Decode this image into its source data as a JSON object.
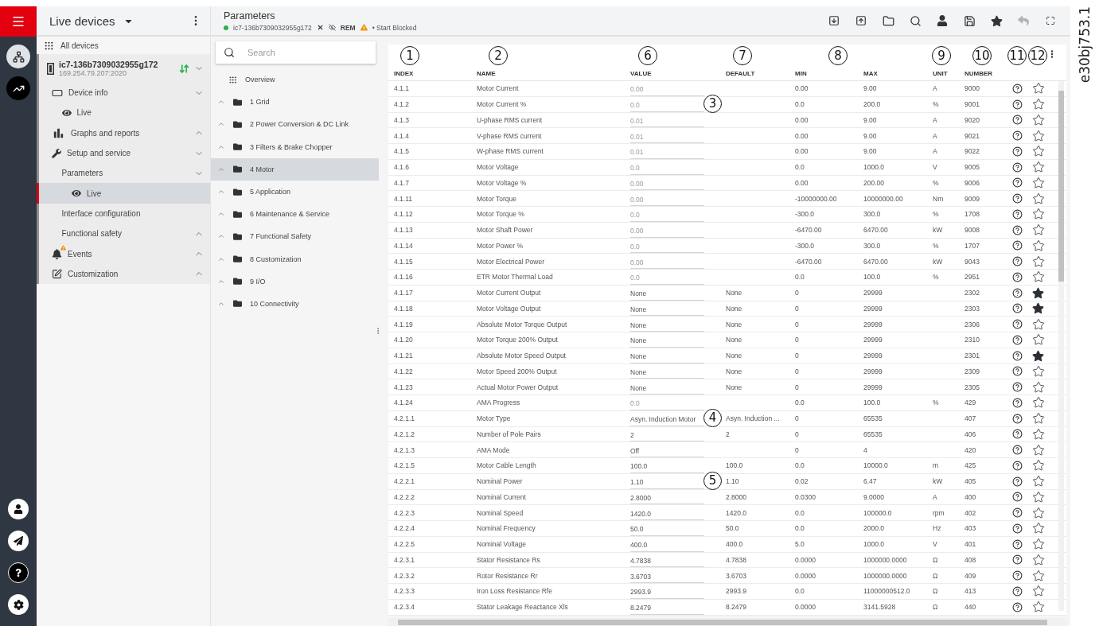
{
  "figure_label": "e30bj753.1",
  "rail": {
    "top": [
      {
        "selected": true
      },
      {
        "selected": false
      }
    ]
  },
  "sidebar": {
    "title": "Live devices",
    "all_devices": "All devices",
    "device": {
      "name": "ic7-136b7309032955g172",
      "address": "169.254.79.207:2020",
      "expanded": true
    },
    "items": [
      {
        "label": "Device info",
        "kind": "group",
        "expanded": true,
        "selected": false,
        "children": [
          {
            "label": "Live",
            "kind": "view",
            "selected": false
          }
        ]
      },
      {
        "label": "Graphs and reports",
        "kind": "group",
        "expanded": false,
        "selected": false
      },
      {
        "label": "Setup and service",
        "kind": "group",
        "expanded": true,
        "selected": false,
        "children": [
          {
            "label": "Parameters",
            "kind": "group",
            "expanded": true,
            "selected": false,
            "children": [
              {
                "label": "Live",
                "kind": "view",
                "selected": true
              }
            ]
          },
          {
            "label": "Interface configuration",
            "kind": "link",
            "selected": false
          },
          {
            "label": "Functional safety",
            "kind": "group",
            "expanded": false,
            "selected": false
          }
        ]
      },
      {
        "label": "Events",
        "kind": "group",
        "expanded": false,
        "selected": false,
        "warning": true
      },
      {
        "label": "Customization",
        "kind": "group",
        "expanded": false,
        "selected": false
      }
    ]
  },
  "header": {
    "title": "Parameters",
    "device": "ic7-136b7309032955g172",
    "online": true,
    "mode": "REM",
    "warning": true,
    "status": "• Start Blocked",
    "toolbar": [
      {
        "disabled": false
      },
      {
        "disabled": false
      },
      {
        "disabled": false
      },
      {
        "disabled": false
      },
      {
        "disabled": false
      },
      {
        "disabled": false
      },
      {
        "disabled": false
      },
      {
        "disabled": true
      },
      {
        "disabled": false
      }
    ]
  },
  "tree": {
    "search": {
      "placeholder": "Search"
    },
    "overview": "Overview",
    "groups": [
      {
        "label": "1 Grid",
        "selected": false
      },
      {
        "label": "2 Power Conversion & DC Link",
        "selected": false
      },
      {
        "label": "3 Filters & Brake Chopper",
        "selected": false
      },
      {
        "label": "4 Motor",
        "selected": true
      },
      {
        "label": "5 Application",
        "selected": false
      },
      {
        "label": "6 Maintenance & Service",
        "selected": false
      },
      {
        "label": "7 Functional Safety",
        "selected": false
      },
      {
        "label": "8 Customization",
        "selected": false
      },
      {
        "label": "9 I/O",
        "selected": false
      },
      {
        "label": "10 Connectivity",
        "selected": false
      }
    ]
  },
  "table": {
    "columns": [
      {
        "label": "INDEX",
        "callout": "1"
      },
      {
        "label": "NAME",
        "callout": "2"
      },
      {
        "label": "VALUE",
        "callout": "6"
      },
      {
        "label": "DEFAULT",
        "callout": "7"
      },
      {
        "label": "MIN",
        "callout": "8"
      },
      {
        "label": "MAX"
      },
      {
        "label": "UNIT",
        "callout": "9"
      },
      {
        "label": "NUMBER",
        "callout": "10"
      },
      {
        "callout": "11"
      },
      {
        "callout": "12"
      }
    ],
    "rows": [
      {
        "index": "4.1.1",
        "name": "Motor Current",
        "value": "0.00",
        "readonly": true,
        "min": "0.00",
        "max": "9.00",
        "unit": "A",
        "number": "9000",
        "favorite": false
      },
      {
        "index": "4.1.2",
        "name": "Motor Current %",
        "value": "0.0",
        "readonly": true,
        "min": "0.0",
        "max": "200.0",
        "unit": "%",
        "number": "9001",
        "favorite": false,
        "callout": "3"
      },
      {
        "index": "4.1.3",
        "name": "U-phase RMS current",
        "value": "0.01",
        "readonly": true,
        "min": "0.00",
        "max": "9.00",
        "unit": "A",
        "number": "9020",
        "favorite": false
      },
      {
        "index": "4.1.4",
        "name": "V-phase RMS current",
        "value": "0.01",
        "readonly": true,
        "min": "0.00",
        "max": "9.00",
        "unit": "A",
        "number": "9021",
        "favorite": false
      },
      {
        "index": "4.1.5",
        "name": "W-phase RMS current",
        "value": "0.01",
        "readonly": true,
        "min": "0.00",
        "max": "9.00",
        "unit": "A",
        "number": "9022",
        "favorite": false
      },
      {
        "index": "4.1.6",
        "name": "Motor Voltage",
        "value": "0.0",
        "readonly": true,
        "min": "0.0",
        "max": "1000.0",
        "unit": "V",
        "number": "9005",
        "favorite": false
      },
      {
        "index": "4.1.7",
        "name": "Motor Voltage %",
        "value": "0.00",
        "readonly": true,
        "min": "0.00",
        "max": "200.00",
        "unit": "%",
        "number": "9006",
        "favorite": false
      },
      {
        "index": "4.1.11",
        "name": "Motor Torque",
        "value": "0.00",
        "readonly": true,
        "min": "-10000000.00",
        "max": "10000000.00",
        "unit": "Nm",
        "number": "9009",
        "favorite": false
      },
      {
        "index": "4.1.12",
        "name": "Motor Torque %",
        "value": "0.0",
        "readonly": true,
        "min": "-300.0",
        "max": "300.0",
        "unit": "%",
        "number": "1708",
        "favorite": false
      },
      {
        "index": "4.1.13",
        "name": "Motor Shaft Power",
        "value": "0.00",
        "readonly": true,
        "min": "-6470.00",
        "max": "6470.00",
        "unit": "kW",
        "number": "9008",
        "favorite": false
      },
      {
        "index": "4.1.14",
        "name": "Motor Power %",
        "value": "0.0",
        "readonly": true,
        "min": "-300.0",
        "max": "300.0",
        "unit": "%",
        "number": "1707",
        "favorite": false
      },
      {
        "index": "4.1.15",
        "name": "Motor Electrical Power",
        "value": "0.00",
        "readonly": true,
        "min": "-6470.00",
        "max": "6470.00",
        "unit": "kW",
        "number": "9043",
        "favorite": false
      },
      {
        "index": "4.1.16",
        "name": "ETR Motor Thermal Load",
        "value": "0.0",
        "readonly": true,
        "min": "0.0",
        "max": "100.0",
        "unit": "%",
        "number": "2951",
        "favorite": false
      },
      {
        "index": "4.1.17",
        "name": "Motor Current Output",
        "value": "None",
        "readonly": false,
        "default": "None",
        "min": "0",
        "max": "29999",
        "number": "2302",
        "favorite": true
      },
      {
        "index": "4.1.18",
        "name": "Motor Voltage Output",
        "value": "None",
        "readonly": false,
        "default": "None",
        "min": "0",
        "max": "29999",
        "number": "2303",
        "favorite": true
      },
      {
        "index": "4.1.19",
        "name": "Absolute Motor Torque Output",
        "value": "None",
        "readonly": false,
        "default": "None",
        "min": "0",
        "max": "29999",
        "number": "2306",
        "favorite": false
      },
      {
        "index": "4.1.20",
        "name": "Motor Torque 200% Output",
        "value": "None",
        "readonly": false,
        "default": "None",
        "min": "0",
        "max": "29999",
        "number": "2310",
        "favorite": false
      },
      {
        "index": "4.1.21",
        "name": "Absolute Motor Speed Output",
        "value": "None",
        "readonly": false,
        "default": "None",
        "min": "0",
        "max": "29999",
        "number": "2301",
        "favorite": true
      },
      {
        "index": "4.1.22",
        "name": "Motor Speed 200% Output",
        "value": "None",
        "readonly": false,
        "default": "None",
        "min": "0",
        "max": "29999",
        "number": "2309",
        "favorite": false
      },
      {
        "index": "4.1.23",
        "name": "Actual Motor Power Output",
        "value": "None",
        "readonly": false,
        "default": "None",
        "min": "0",
        "max": "29999",
        "number": "2305",
        "favorite": false
      },
      {
        "index": "4.1.24",
        "name": "AMA Progress",
        "value": "0.0",
        "readonly": true,
        "min": "0.0",
        "max": "100.0",
        "unit": "%",
        "number": "429",
        "favorite": false
      },
      {
        "index": "4.2.1.1",
        "name": "Motor Type",
        "value": "Asyn. Induction Motor",
        "readonly": false,
        "default": "Asyn. Induction ...",
        "min": "0",
        "max": "65535",
        "number": "407",
        "favorite": false,
        "callout": "4"
      },
      {
        "index": "4.2.1.2",
        "name": "Number of Pole Pairs",
        "value": "2",
        "readonly": false,
        "default": "2",
        "min": "0",
        "max": "65535",
        "number": "406",
        "favorite": false
      },
      {
        "index": "4.2.1.3",
        "name": "AMA Mode",
        "value": "Off",
        "readonly": false,
        "min": "0",
        "max": "4",
        "number": "420",
        "favorite": false
      },
      {
        "index": "4.2.1.5",
        "name": "Motor Cable Length",
        "value": "100.0",
        "readonly": false,
        "default": "100.0",
        "min": "0.0",
        "max": "10000.0",
        "unit": "m",
        "number": "425",
        "favorite": false
      },
      {
        "index": "4.2.2.1",
        "name": "Nominal Power",
        "value": "1.10",
        "readonly": false,
        "default": "1.10",
        "min": "0.02",
        "max": "6.47",
        "unit": "kW",
        "number": "405",
        "favorite": false,
        "callout": "5"
      },
      {
        "index": "4.2.2.2",
        "name": "Nominal Current",
        "value": "2.8000",
        "readonly": false,
        "default": "2.8000",
        "min": "0.0300",
        "max": "9.0000",
        "unit": "A",
        "number": "400",
        "favorite": false
      },
      {
        "index": "4.2.2.3",
        "name": "Nominal Speed",
        "value": "1420.0",
        "readonly": false,
        "default": "1420.0",
        "min": "0.0",
        "max": "100000.0",
        "unit": "rpm",
        "number": "402",
        "favorite": false
      },
      {
        "index": "4.2.2.4",
        "name": "Nominal Frequency",
        "value": "50.0",
        "readonly": false,
        "default": "50.0",
        "min": "0.0",
        "max": "2000.0",
        "unit": "Hz",
        "number": "403",
        "favorite": false
      },
      {
        "index": "4.2.2.5",
        "name": "Nominal Voltage",
        "value": "400.0",
        "readonly": false,
        "default": "400.0",
        "min": "5.0",
        "max": "1000.0",
        "unit": "V",
        "number": "401",
        "favorite": false
      },
      {
        "index": "4.2.3.1",
        "name": "Stator Resistance Rs",
        "value": "4.7838",
        "readonly": false,
        "default": "4.7838",
        "min": "0.0000",
        "max": "1000000.0000",
        "unit": "Ω",
        "number": "408",
        "favorite": false
      },
      {
        "index": "4.2.3.2",
        "name": "Rotor Resistance Rr",
        "value": "3.6703",
        "readonly": false,
        "default": "3.6703",
        "min": "0.0000",
        "max": "1000000.0000",
        "unit": "Ω",
        "number": "409",
        "favorite": false
      },
      {
        "index": "4.2.3.3",
        "name": "Iron Loss Resistance Rfe",
        "value": "2993.9",
        "readonly": false,
        "default": "2993.9",
        "min": "0.0",
        "max": "11000000512.0",
        "unit": "Ω",
        "number": "413",
        "favorite": false
      },
      {
        "index": "4.2.3.4",
        "name": "Stator Leakage Reactance Xls",
        "value": "8.2479",
        "readonly": false,
        "default": "8.2479",
        "min": "0.0000",
        "max": "3141.5928",
        "unit": "Ω",
        "number": "440",
        "favorite": false
      }
    ]
  }
}
